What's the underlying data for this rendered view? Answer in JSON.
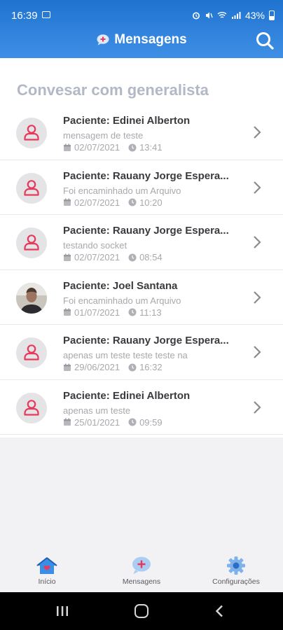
{
  "status_bar": {
    "time": "16:39",
    "battery": "43%"
  },
  "header": {
    "title": "Mensagens"
  },
  "section_title": "Convesar com generalista",
  "conversations": [
    {
      "name": "Paciente: Edinei Alberton",
      "message": "mensagem de teste",
      "date": "02/07/2021",
      "time": "13:41",
      "avatar": "person-icon"
    },
    {
      "name": "Paciente: Rauany Jorge Espera...",
      "message": "Foi encaminhado um Arquivo",
      "date": "02/07/2021",
      "time": "10:20",
      "avatar": "person-icon"
    },
    {
      "name": "Paciente: Rauany Jorge Espera...",
      "message": "testando socket",
      "date": "02/07/2021",
      "time": "08:54",
      "avatar": "person-icon"
    },
    {
      "name": "Paciente: Joel Santana",
      "message": "Foi encaminhado um Arquivo",
      "date": "01/07/2021",
      "time": "11:13",
      "avatar": "photo"
    },
    {
      "name": "Paciente: Rauany Jorge Espera...",
      "message": "apenas um teste teste teste na",
      "date": "29/06/2021",
      "time": "16:32",
      "avatar": "person-icon"
    },
    {
      "name": "Paciente: Edinei Alberton",
      "message": "apenas um teste",
      "date": "25/01/2021",
      "time": "09:59",
      "avatar": "person-icon"
    }
  ],
  "tabs": [
    {
      "label": "Início",
      "icon": "home-icon"
    },
    {
      "label": "Mensagens",
      "icon": "chat-plus-icon"
    },
    {
      "label": "Configurações",
      "icon": "gear-icon"
    }
  ],
  "colors": {
    "header": "#2a7fdb",
    "accent": "#e8395a",
    "muted": "#a8a8ae"
  }
}
